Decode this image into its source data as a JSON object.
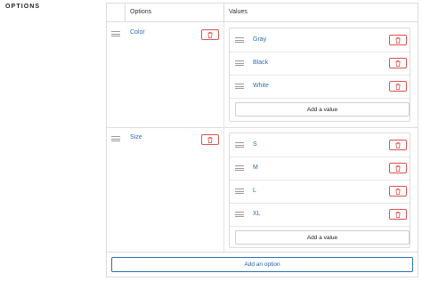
{
  "section_label": "OPTIONS",
  "table": {
    "col_options": "Options",
    "col_values": "Values"
  },
  "options": [
    {
      "name": "Color",
      "values": [
        "Gray",
        "Black",
        "White"
      ],
      "add_value_label": "Add a value"
    },
    {
      "name": "Size",
      "values": [
        "S",
        "M",
        "L",
        "XL"
      ],
      "add_value_label": "Add a value"
    }
  ],
  "add_option_label": "Add an option",
  "colors": {
    "link": "#2a6fb0",
    "danger": "#d9534f",
    "border": "#dcdcdc"
  }
}
